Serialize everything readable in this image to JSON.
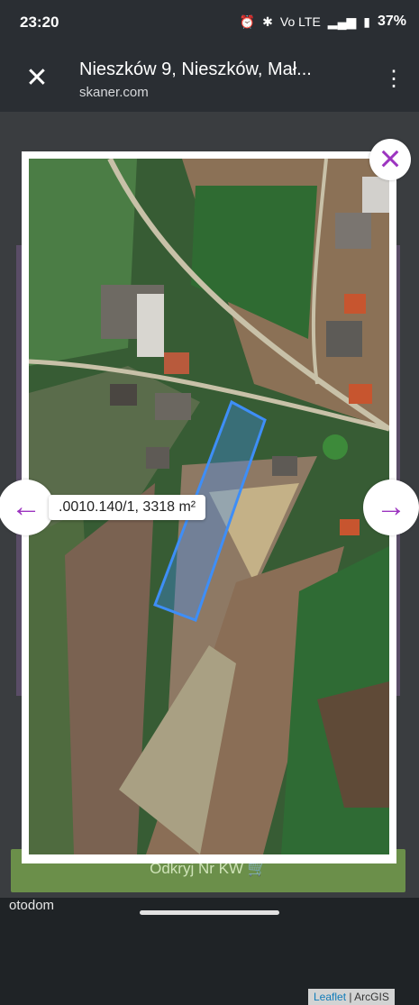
{
  "status": {
    "time": "23:20",
    "battery": "37%",
    "network": "Vo LTE"
  },
  "browser": {
    "title": "Nieszków 9, Nieszków, Mał...",
    "url": "skaner.com"
  },
  "map": {
    "parcel_label": ".0010.140/1, 3318 m²",
    "attribution": {
      "leaflet": "Leaflet",
      "sep": "|",
      "provider": "ArcGIS"
    }
  },
  "underlying": {
    "button_label": "Odkryj Nr KW 🛒"
  },
  "footer": {
    "brand": "otodom"
  },
  "colors": {
    "accent": "#9c34c0",
    "parcel": "#3e8ef7",
    "map": "#355f33"
  }
}
